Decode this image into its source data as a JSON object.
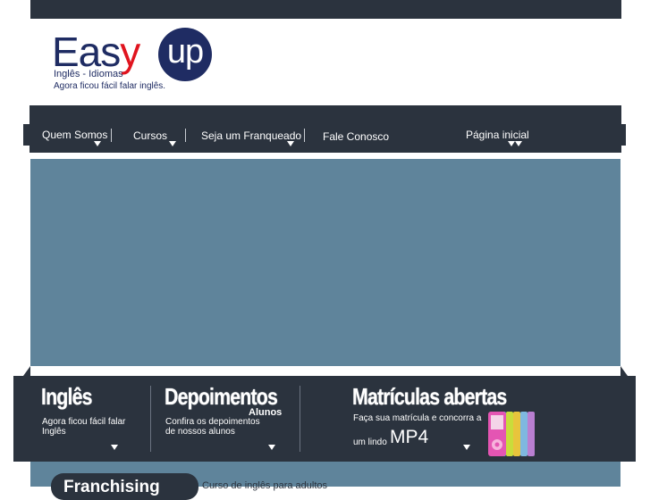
{
  "logo": {
    "brand_left": "Easy",
    "brand_y": "y",
    "brand_right": "up",
    "line1": "Inglês - Idiomas",
    "line2": "Agora ficou fácil falar inglês."
  },
  "nav": {
    "items": [
      {
        "label": "Quem Somos"
      },
      {
        "label": "Cursos"
      },
      {
        "label": "Seja um Franqueado"
      },
      {
        "label": "Fale Conosco"
      },
      {
        "label": "Página inicial"
      }
    ]
  },
  "band": {
    "ingles": {
      "title": "Inglês",
      "text1": "Agora ficou fácil falar",
      "text2": "Inglês"
    },
    "depoimentos": {
      "title": "Depoimentos",
      "badge": "Alunos",
      "text1": "Confira os depoimentos",
      "text2": "de nossos alunos"
    },
    "matriculas": {
      "title": "Matrículas abertas",
      "text1": "Faça sua matrícula e concorra a",
      "text2": "um lindo",
      "prize": "MP4"
    }
  },
  "bottom": {
    "pill_label": "Franchising",
    "caption": "Curso de inglês para adultos"
  },
  "colors": {
    "dark": "#2b333e",
    "banner": "#5f849b",
    "brand_blue": "#1f2c63",
    "brand_red": "#e0141e"
  }
}
